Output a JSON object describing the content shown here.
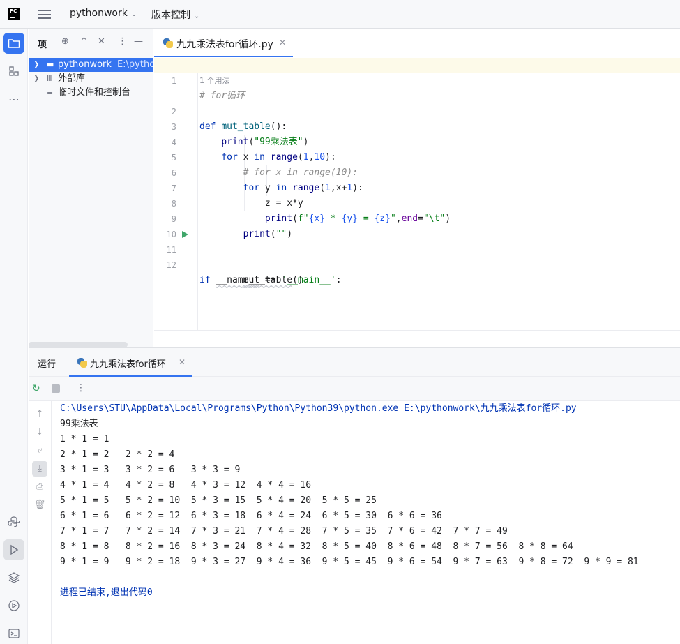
{
  "titlebar": {
    "project_name": "pythonwork",
    "vcs_label": "版本控制"
  },
  "project_panel": {
    "title": "项",
    "tree": [
      {
        "label": "pythonwork",
        "path": "E:\\pythonwork",
        "selected": true,
        "icon": "folder-icon"
      },
      {
        "label": "外部库",
        "path": "",
        "selected": false,
        "icon": "library-icon"
      },
      {
        "label": "临时文件和控制台",
        "path": "",
        "selected": false,
        "icon": "scratch-icon"
      }
    ]
  },
  "editor": {
    "tab_label": "九九乘法表for循环.py",
    "usage_hint": "1 个用法",
    "line_numbers": [
      "1",
      "2",
      "3",
      "4",
      "5",
      "6",
      "7",
      "8",
      "9",
      "10",
      "11",
      "12"
    ]
  },
  "run_panel": {
    "title": "运行",
    "tab_label": "九九乘法表for循环",
    "output": [
      "C:\\Users\\STU\\AppData\\Local\\Programs\\Python\\Python39\\python.exe E:\\pythonwork\\九九乘法表for循环.py",
      "99乘法表",
      "1 * 1 = 1",
      "2 * 1 = 2   2 * 2 = 4",
      "3 * 1 = 3   3 * 2 = 6   3 * 3 = 9",
      "4 * 1 = 4   4 * 2 = 8   4 * 3 = 12  4 * 4 = 16",
      "5 * 1 = 5   5 * 2 = 10  5 * 3 = 15  5 * 4 = 20  5 * 5 = 25",
      "6 * 1 = 6   6 * 2 = 12  6 * 3 = 18  6 * 4 = 24  6 * 5 = 30  6 * 6 = 36",
      "7 * 1 = 7   7 * 2 = 14  7 * 3 = 21  7 * 4 = 28  7 * 5 = 35  7 * 6 = 42  7 * 7 = 49",
      "8 * 1 = 8   8 * 2 = 16  8 * 3 = 24  8 * 4 = 32  8 * 5 = 40  8 * 6 = 48  8 * 7 = 56  8 * 8 = 64",
      "9 * 1 = 9   9 * 2 = 18  9 * 3 = 27  9 * 4 = 36  9 * 5 = 45  9 * 6 = 54  9 * 7 = 63  9 * 8 = 72  9 * 9 = 81",
      "",
      "进程已结束,退出代码0"
    ]
  },
  "colors": {
    "accent": "#3574f0",
    "keyword": "#0033b3",
    "string": "#067d17",
    "number": "#1750eb",
    "comment": "#8c8c8c",
    "run_green": "#40a66a"
  }
}
